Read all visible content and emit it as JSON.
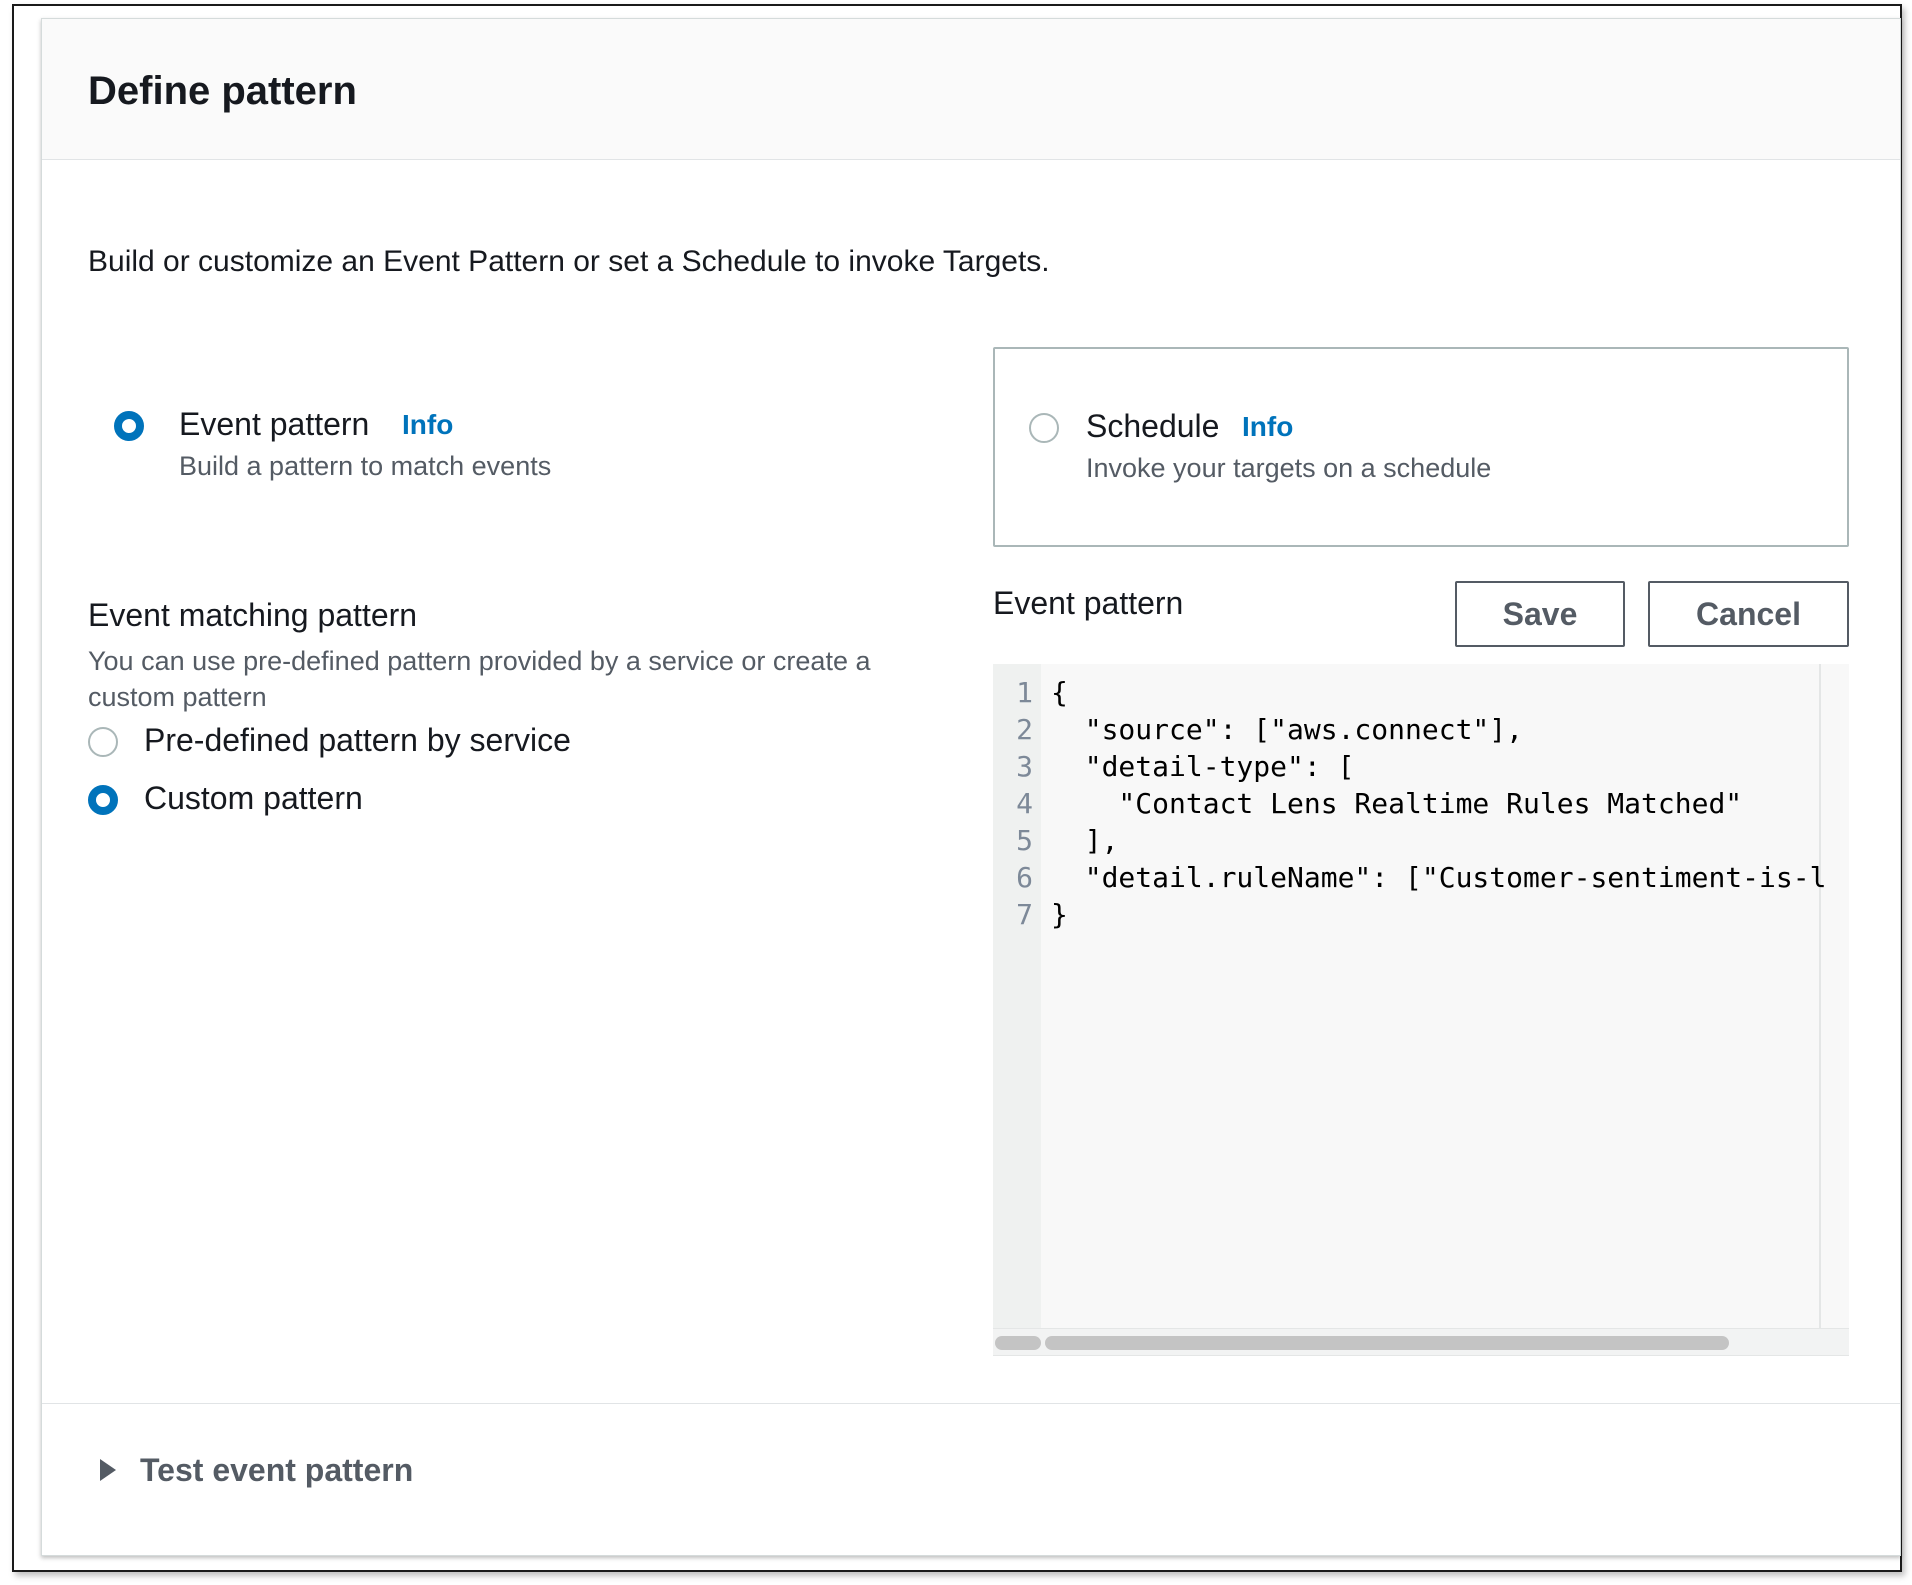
{
  "panel": {
    "title": "Define pattern",
    "description": "Build or customize an Event Pattern or set a Schedule to invoke Targets."
  },
  "rule_type": {
    "options": [
      {
        "label": "Event pattern",
        "info": "Info",
        "description": "Build a pattern to match events",
        "selected": true
      },
      {
        "label": "Schedule",
        "info": "Info",
        "description": "Invoke your targets on a schedule",
        "selected": false
      }
    ]
  },
  "matching": {
    "title": "Event matching pattern",
    "description": "You can use pre-defined pattern provided by a service or create a custom pattern",
    "options": [
      {
        "label": "Pre-defined pattern by service",
        "selected": false
      },
      {
        "label": "Custom pattern",
        "selected": true
      }
    ]
  },
  "editor": {
    "title": "Event pattern",
    "save_label": "Save",
    "cancel_label": "Cancel",
    "lines": [
      {
        "num": "1",
        "text": "{"
      },
      {
        "num": "2",
        "text": "  \"source\": [\"aws.connect\"],"
      },
      {
        "num": "3",
        "text": "  \"detail-type\": ["
      },
      {
        "num": "4",
        "text": "    \"Contact Lens Realtime Rules Matched\""
      },
      {
        "num": "5",
        "text": "  ],"
      },
      {
        "num": "6",
        "text": "  \"detail.ruleName\": [\"Customer-sentiment-is-l"
      },
      {
        "num": "7",
        "text": "}"
      }
    ]
  },
  "test": {
    "label": "Test event pattern"
  },
  "colors": {
    "accent": "#0073bb",
    "text": "#16191f",
    "secondary_text": "#545b64"
  }
}
